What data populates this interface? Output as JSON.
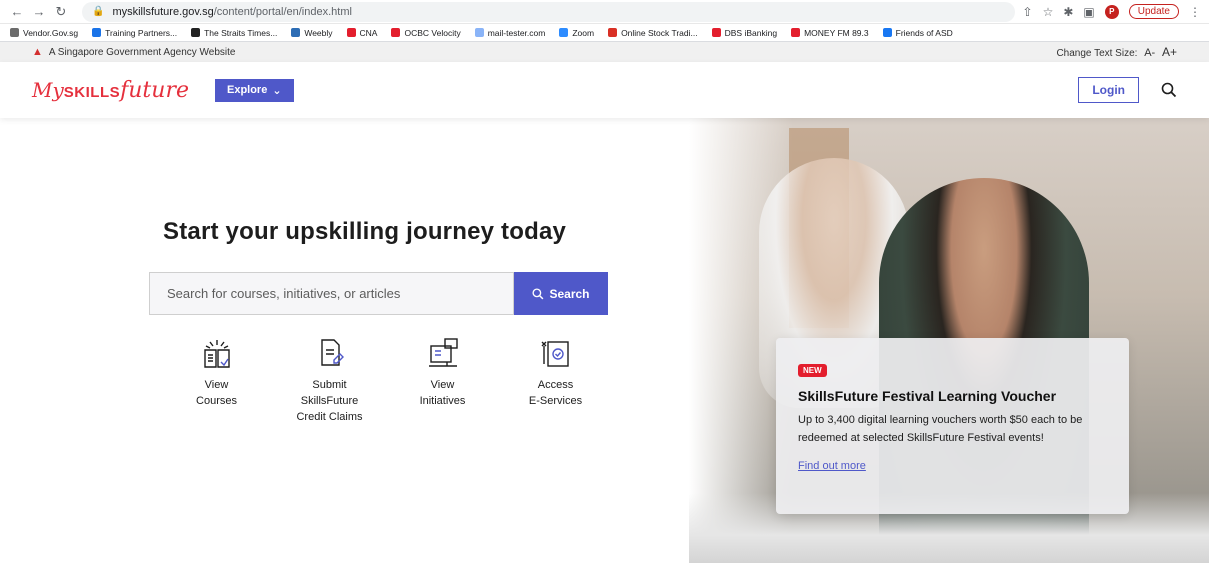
{
  "browser": {
    "url_domain": "myskillsfuture.gov.sg",
    "url_path": "/content/portal/en/index.html",
    "update_label": "Update",
    "profile_initial": "P",
    "bookmarks": [
      {
        "label": "Vendor.Gov.sg",
        "color": "#6b6b6b"
      },
      {
        "label": "Training Partners...",
        "color": "#1a73e8"
      },
      {
        "label": "The Straits Times...",
        "color": "#222222"
      },
      {
        "label": "Weebly",
        "color": "#2d6db5"
      },
      {
        "label": "CNA",
        "color": "#e31e2d"
      },
      {
        "label": "OCBC Velocity",
        "color": "#e31e2d"
      },
      {
        "label": "mail-tester.com",
        "color": "#8ab4f8"
      },
      {
        "label": "Zoom",
        "color": "#2d8cff"
      },
      {
        "label": "Online Stock Tradi...",
        "color": "#d93025"
      },
      {
        "label": "DBS iBanking",
        "color": "#e31e2d"
      },
      {
        "label": "MONEY FM 89.3",
        "color": "#e31e2d"
      },
      {
        "label": "Friends of ASD",
        "color": "#1877f2"
      }
    ]
  },
  "gov_banner": {
    "text": "A Singapore Government Agency Website",
    "text_size_label": "Change Text Size:",
    "a_minus": "A-",
    "a_plus": "A+"
  },
  "header": {
    "logo_my": "My",
    "logo_skills": "SKILLS",
    "logo_future": "future",
    "explore_label": "Explore",
    "login_label": "Login"
  },
  "hero": {
    "title": "Start your upskilling journey today",
    "search_placeholder": "Search for courses, initiatives, or articles",
    "search_button": "Search",
    "quick_links": [
      {
        "line1": "View",
        "line2": "Courses",
        "line3": "",
        "icon": "book-icon"
      },
      {
        "line1": "Submit",
        "line2": "SkillsFuture",
        "line3": "Credit Claims",
        "icon": "claim-document-icon"
      },
      {
        "line1": "View",
        "line2": "Initiatives",
        "line3": "",
        "icon": "initiatives-icon"
      },
      {
        "line1": "Access",
        "line2": "E-Services",
        "line3": "",
        "icon": "eservices-icon"
      }
    ]
  },
  "promo": {
    "badge": "NEW",
    "title": "SkillsFuture Festival Learning Voucher",
    "text": "Up to 3,400 digital learning vouchers worth $50 each to be redeemed at selected SkillsFuture Festival events!",
    "link": "Find out more"
  },
  "colors": {
    "brand_red": "#e5303d",
    "primary_blue": "#4f58c9",
    "badge_red": "#e31e2d"
  }
}
